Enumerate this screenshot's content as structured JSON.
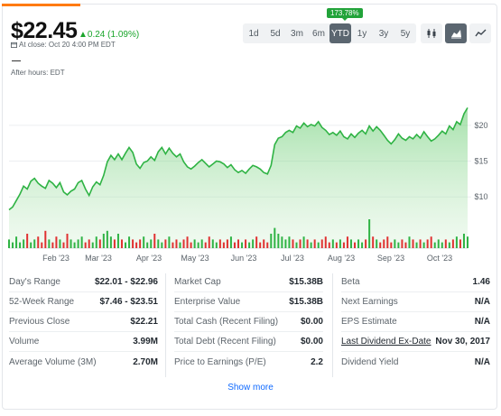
{
  "quote": {
    "price": "$22.45",
    "change": "0.24 (1.09%)",
    "close_time": "At close: Oct 20 4:00 PM EDT",
    "after_hours_value": "—",
    "after_hours_label": "After hours: EDT"
  },
  "periods": [
    "1d",
    "5d",
    "3m",
    "6m",
    "YTD",
    "1y",
    "3y",
    "5y"
  ],
  "active_period": "YTD",
  "ytd_badge": "173.78%",
  "chart_data": {
    "type": "area",
    "x_tick_labels": [
      "Feb '23",
      "Mar '23",
      "Apr '23",
      "May '23",
      "Jun '23",
      "Jul '23",
      "Aug '23",
      "Sep '23",
      "Oct '23"
    ],
    "y_tick_labels": [
      "$20",
      "$15",
      "$10"
    ],
    "y_ticks": [
      20,
      15,
      10
    ],
    "ylim": [
      6,
      23
    ],
    "values": [
      8.2,
      8.6,
      9.5,
      10.4,
      11.5,
      11.1,
      12.2,
      12.6,
      11.9,
      11.5,
      11.2,
      12.3,
      11.9,
      11.3,
      12.0,
      10.7,
      10.3,
      10.8,
      11.1,
      12.0,
      12.3,
      11.1,
      10.2,
      11.4,
      12.1,
      11.7,
      13.0,
      14.9,
      15.8,
      15.2,
      16.0,
      15.2,
      16.1,
      16.9,
      16.2,
      14.6,
      14.0,
      14.8,
      15.0,
      15.6,
      15.1,
      16.3,
      16.9,
      16.0,
      16.8,
      16.1,
      15.6,
      16.0,
      14.9,
      14.2,
      13.9,
      14.3,
      14.8,
      15.2,
      14.7,
      14.2,
      14.6,
      15.0,
      14.9,
      14.6,
      14.1,
      14.5,
      13.8,
      13.4,
      13.7,
      13.3,
      13.9,
      14.4,
      14.2,
      13.9,
      13.4,
      13.2,
      14.4,
      17.3,
      18.2,
      18.4,
      19.0,
      19.3,
      19.0,
      19.9,
      19.6,
      20.3,
      19.8,
      20.1,
      19.9,
      20.5,
      19.7,
      19.3,
      18.7,
      19.0,
      18.6,
      19.2,
      18.4,
      18.1,
      18.8,
      18.3,
      18.9,
      19.3,
      18.8,
      19.9,
      19.2,
      19.8,
      19.3,
      18.6,
      17.9,
      17.4,
      18.0,
      18.8,
      18.2,
      17.9,
      18.4,
      18.1,
      18.7,
      18.2,
      19.1,
      18.4,
      17.8,
      18.1,
      18.6,
      19.2,
      18.8,
      19.9,
      19.4,
      20.5,
      20.1,
      21.6,
      22.45
    ],
    "volume_heights": [
      0.3,
      0.2,
      0.4,
      0.2,
      0.3,
      0.5,
      0.2,
      0.3,
      0.4,
      0.2,
      0.6,
      0.3,
      0.2,
      0.4,
      0.3,
      0.2,
      0.5,
      0.3,
      0.2,
      0.3,
      0.4,
      0.2,
      0.3,
      0.2,
      0.4,
      0.3,
      0.5,
      0.6,
      0.4,
      0.3,
      0.5,
      0.3,
      0.2,
      0.4,
      0.3,
      0.2,
      0.3,
      0.4,
      0.2,
      0.3,
      0.5,
      0.3,
      0.2,
      0.3,
      0.4,
      0.2,
      0.3,
      0.2,
      0.3,
      0.4,
      0.2,
      0.3,
      0.2,
      0.3,
      0.2,
      0.4,
      0.3,
      0.2,
      0.3,
      0.2,
      0.3,
      0.4,
      0.2,
      0.3,
      0.2,
      0.3,
      0.2,
      0.3,
      0.4,
      0.2,
      0.3,
      0.2,
      0.5,
      0.7,
      0.5,
      0.4,
      0.3,
      0.4,
      0.3,
      0.2,
      0.3,
      0.4,
      0.3,
      0.2,
      0.3,
      0.2,
      0.3,
      0.4,
      0.2,
      0.3,
      0.2,
      0.3,
      0.2,
      0.4,
      0.3,
      0.2,
      0.3,
      0.2,
      0.3,
      1.0,
      0.4,
      0.3,
      0.2,
      0.3,
      0.4,
      0.2,
      0.3,
      0.2,
      0.3,
      0.2,
      0.4,
      0.3,
      0.2,
      0.3,
      0.2,
      0.3,
      0.4,
      0.2,
      0.3,
      0.2,
      0.3,
      0.2,
      0.3,
      0.4,
      0.3,
      0.5,
      0.4
    ],
    "volume_colors": [
      "#e03131",
      "#2fb344"
    ]
  },
  "stats": {
    "col1": [
      {
        "label": "Day's Range",
        "value": "$22.01 - $22.96"
      },
      {
        "label": "52-Week Range",
        "value": "$7.46 - $23.51"
      },
      {
        "label": "Previous Close",
        "value": "$22.21"
      },
      {
        "label": "Volume",
        "value": "3.99M"
      },
      {
        "label": "Average Volume (3M)",
        "value": "2.70M"
      }
    ],
    "col2": [
      {
        "label": "Market Cap",
        "value": "$15.38B"
      },
      {
        "label": "Enterprise Value",
        "value": "$15.38B"
      },
      {
        "label": "Total Cash (Recent Filing)",
        "value": "$0.00"
      },
      {
        "label": "Total Debt (Recent Filing)",
        "value": "$0.00"
      },
      {
        "label": "Price to Earnings (P/E)",
        "value": "2.2"
      }
    ],
    "col3": [
      {
        "label": "Beta",
        "value": "1.46"
      },
      {
        "label": "Next Earnings",
        "value": "N/A"
      },
      {
        "label": "EPS Estimate",
        "value": "N/A"
      },
      {
        "label": "Last Dividend Ex-Date",
        "value": "Nov 30, 2017"
      },
      {
        "label": "Dividend Yield",
        "value": "N/A"
      }
    ]
  },
  "show_more": "Show more",
  "colors": {
    "accent": "#ff7b12",
    "up": "#1aa52b",
    "link": "#0f69ff",
    "line": "#2fb344"
  }
}
